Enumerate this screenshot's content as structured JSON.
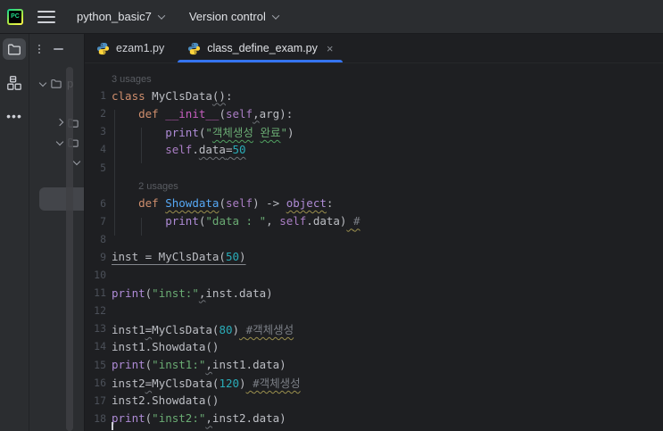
{
  "titlebar": {
    "project": "python_basic7",
    "vcs": "Version control"
  },
  "stripe": [
    {
      "icon": "folder-icon",
      "selected": true
    },
    {
      "icon": "structure-icon",
      "selected": false
    },
    {
      "icon": "more-icon",
      "selected": false
    }
  ],
  "panel": {
    "tree_rows": [
      {
        "chevron": "down",
        "icon": "folder",
        "label": "p",
        "indent": 0
      },
      {
        "chevron": "none",
        "icon": "folder",
        "label": "",
        "indent": 2
      },
      {
        "chevron": "right",
        "icon": "folder",
        "label": "",
        "indent": 1
      },
      {
        "chevron": "down",
        "icon": "folder",
        "label": "",
        "indent": 1
      },
      {
        "chevron": "down",
        "icon": "",
        "label": "",
        "indent": 2
      }
    ]
  },
  "tabs": [
    {
      "label": "ezam1.py",
      "active": false,
      "closable": false
    },
    {
      "label": "class_define_exam.py",
      "active": true,
      "closable": true,
      "close_glyph": "×"
    }
  ],
  "editor": {
    "lines": [
      {
        "inlay": "3 usages",
        "ind": 0
      },
      {
        "n": "1",
        "tok": [
          [
            "kw",
            "class"
          ],
          [
            "pl",
            " MyClsData"
          ],
          [
            "pl",
            "()",
            "wgr"
          ],
          [
            "pl",
            ":"
          ]
        ]
      },
      {
        "n": "2",
        "tok": [
          [
            "pl",
            "    "
          ],
          [
            "kw",
            "def"
          ],
          [
            "pl",
            " "
          ],
          [
            "mg",
            "__init__"
          ],
          [
            "pl",
            "("
          ],
          [
            "sf",
            "self"
          ],
          [
            "pl",
            ",",
            "wgr"
          ],
          [
            "pl",
            "arg):"
          ]
        ]
      },
      {
        "n": "3",
        "tok": [
          [
            "pl",
            "        "
          ],
          [
            "bi",
            "print"
          ],
          [
            "pl",
            "("
          ],
          [
            "st",
            "\""
          ],
          [
            "st",
            "객체생성",
            "wg"
          ],
          [
            "st",
            " "
          ],
          [
            "st",
            "완료",
            "wg"
          ],
          [
            "st",
            "\""
          ],
          [
            "pl",
            ")"
          ]
        ]
      },
      {
        "n": "4",
        "tok": [
          [
            "pl",
            "        "
          ],
          [
            "sf",
            "self"
          ],
          [
            "pl",
            "."
          ],
          [
            "pl",
            "data",
            "wgr"
          ],
          [
            "pl",
            "=",
            "wgr"
          ],
          [
            "nu",
            "50",
            "wgr"
          ]
        ]
      },
      {
        "n": "5",
        "tok": []
      },
      {
        "inlay": "2 usages",
        "ind": 4
      },
      {
        "n": "6",
        "tok": [
          [
            "pl",
            "    "
          ],
          [
            "kw",
            "def"
          ],
          [
            "pl",
            " "
          ],
          [
            "fn",
            "Showdata",
            "wy"
          ],
          [
            "pl",
            "("
          ],
          [
            "sf",
            "self"
          ],
          [
            "pl",
            ") -> "
          ],
          [
            "bi",
            "object",
            "wy"
          ],
          [
            "pl",
            ":"
          ]
        ]
      },
      {
        "n": "7",
        "tok": [
          [
            "pl",
            "        "
          ],
          [
            "bi",
            "print"
          ],
          [
            "pl",
            "("
          ],
          [
            "st",
            "\"data : \""
          ],
          [
            "pl",
            ", "
          ],
          [
            "sf",
            "self"
          ],
          [
            "pl",
            ".data)"
          ],
          [
            "pl",
            " ",
            "wy"
          ],
          [
            "cm",
            "#",
            "wy"
          ]
        ]
      },
      {
        "n": "8",
        "tok": []
      },
      {
        "n": "9",
        "tok": [
          [
            "pl",
            "inst = MyClsData(",
            "sol"
          ],
          [
            "nu",
            "50",
            "sol"
          ],
          [
            "pl",
            ")",
            "sol"
          ]
        ]
      },
      {
        "n": "10",
        "tok": []
      },
      {
        "n": "11",
        "tok": [
          [
            "bi",
            "print"
          ],
          [
            "pl",
            "("
          ],
          [
            "st",
            "\"inst:\""
          ],
          [
            "pl",
            ",",
            "wgr"
          ],
          [
            "pl",
            "inst.data)"
          ]
        ]
      },
      {
        "n": "12",
        "tok": []
      },
      {
        "n": "13",
        "tok": [
          [
            "pl",
            "inst1"
          ],
          [
            "pl",
            "=",
            "wgr"
          ],
          [
            "pl",
            "MyClsData("
          ],
          [
            "nu",
            "80"
          ],
          [
            "pl",
            ")"
          ],
          [
            "pl",
            " ",
            "wy"
          ],
          [
            "cm",
            "#객체생성",
            "wy"
          ]
        ]
      },
      {
        "n": "14",
        "tok": [
          [
            "pl",
            "inst1.Showdata()"
          ]
        ]
      },
      {
        "n": "15",
        "tok": [
          [
            "bi",
            "print"
          ],
          [
            "pl",
            "("
          ],
          [
            "st",
            "\"inst1:\""
          ],
          [
            "pl",
            ",",
            "wgr"
          ],
          [
            "pl",
            "inst1.data)"
          ]
        ]
      },
      {
        "n": "16",
        "tok": [
          [
            "pl",
            "inst2"
          ],
          [
            "pl",
            "=",
            "wgr"
          ],
          [
            "pl",
            "MyClsData("
          ],
          [
            "nu",
            "120"
          ],
          [
            "pl",
            ")"
          ],
          [
            "pl",
            " ",
            "wy"
          ],
          [
            "cm",
            "#객체생성",
            "wy"
          ]
        ]
      },
      {
        "n": "17",
        "tok": [
          [
            "pl",
            "inst2.Showdata()"
          ]
        ]
      },
      {
        "n": "18",
        "tok": [
          [
            "bi",
            "print"
          ],
          [
            "pl",
            "("
          ],
          [
            "st",
            "\"inst2:\""
          ],
          [
            "pl",
            ",",
            "wgr"
          ],
          [
            "pl",
            "inst2.data)"
          ]
        ]
      }
    ]
  },
  "colors": {
    "accent_blue": "#3574F0",
    "editor_bg": "#1E1F22",
    "panel_bg": "#2B2D30",
    "keyword": "#CF8E6D",
    "string": "#6AAB73",
    "number": "#2AACB8",
    "comment": "#7A7E85",
    "builtin": "#AE8BD6",
    "magic_method": "#C75FC0",
    "function_decl": "#56A8F5",
    "python_blue": "#4B8BBE",
    "python_yellow": "#FFD43B",
    "pycharm_green": "#21D789",
    "pycharm_yellow": "#FCF84A",
    "logo_text": "PC"
  }
}
